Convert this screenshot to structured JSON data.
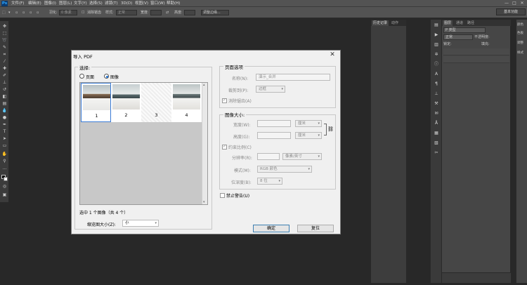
{
  "app": {
    "logo": "Ps",
    "menu": [
      "文件(F)",
      "编辑(E)",
      "图像(I)",
      "图层(L)",
      "文字(Y)",
      "选择(S)",
      "滤镜(T)",
      "3D(D)",
      "视图(V)",
      "窗口(W)",
      "帮助(H)"
    ],
    "window_controls": [
      "—",
      "□",
      "✕"
    ]
  },
  "options_bar": {
    "feather_label": "羽化:",
    "feather_value": "0 像素",
    "antialias_label": "消除锯齿",
    "style_label": "样式:",
    "style_value": "正常",
    "width_label": "宽度:",
    "height_label": "高度:",
    "refine_button": "调整边缘...",
    "workspace": "基本功能"
  },
  "panels": {
    "history_tabs": [
      "历史记录",
      "动作"
    ],
    "layers_tabs": [
      "图层",
      "通道",
      "路径"
    ],
    "kind_label": "P 类型",
    "blend_mode": "正常",
    "opacity_label": "不透明度:",
    "lock_label": "锁定:",
    "fill_label": "填充:",
    "right_items": [
      "颜色",
      "色板",
      "调整",
      "样式"
    ]
  },
  "dialog": {
    "title": "导入 PDF",
    "select_group_label": "选择:",
    "radio_pages": "页面",
    "radio_images": "图像",
    "radio_selected": "images",
    "thumbnails": [
      {
        "num": "1",
        "selected": true,
        "type": "photo"
      },
      {
        "num": "2",
        "selected": false,
        "type": "photo"
      },
      {
        "num": "3",
        "selected": false,
        "type": "blank"
      },
      {
        "num": "4",
        "selected": false,
        "type": "photo"
      }
    ],
    "status_text": "选中 1 个图像（共 4 个）",
    "thumb_size_label": "缩览图大小(Z):",
    "thumb_size_value": "小",
    "page_options": {
      "group_label": "页面选项",
      "name_label": "名称(N):",
      "name_value": "演示_合并",
      "crop_label": "裁剪到(P):",
      "crop_value": "边框",
      "antialias_label": "消除锯齿(A)",
      "antialias_checked": true
    },
    "image_size": {
      "group_label": "图像大小:",
      "width_label": "宽度(W):",
      "width_unit": "厘米",
      "height_label": "高度(G):",
      "height_unit": "厘米",
      "constrain_label": "约束比例(C)",
      "constrain_checked": true,
      "resolution_label": "分辨率(R):",
      "resolution_unit": "像素/英寸",
      "mode_label": "模式(M):",
      "mode_value": "RGB 颜色",
      "depth_label": "位深度(B):",
      "depth_value": "8 位"
    },
    "suppress_warnings_label": "禁止警告(U)",
    "suppress_warnings_checked": false,
    "ok_button": "确定",
    "reset_button": "复位"
  }
}
